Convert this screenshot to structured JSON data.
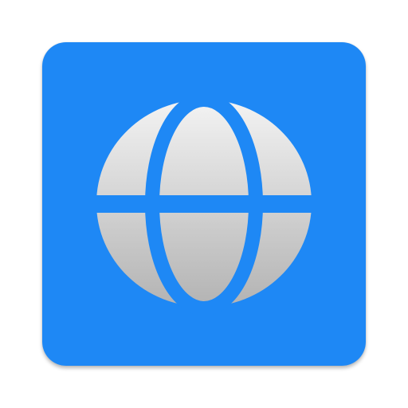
{
  "app_icon": {
    "icon": "globe-icon",
    "colors": {
      "background": "#1e88f5",
      "globe_light": "#f3f3f3",
      "globe_dark": "#b3b3b3",
      "separator": "#1e88f5"
    }
  }
}
